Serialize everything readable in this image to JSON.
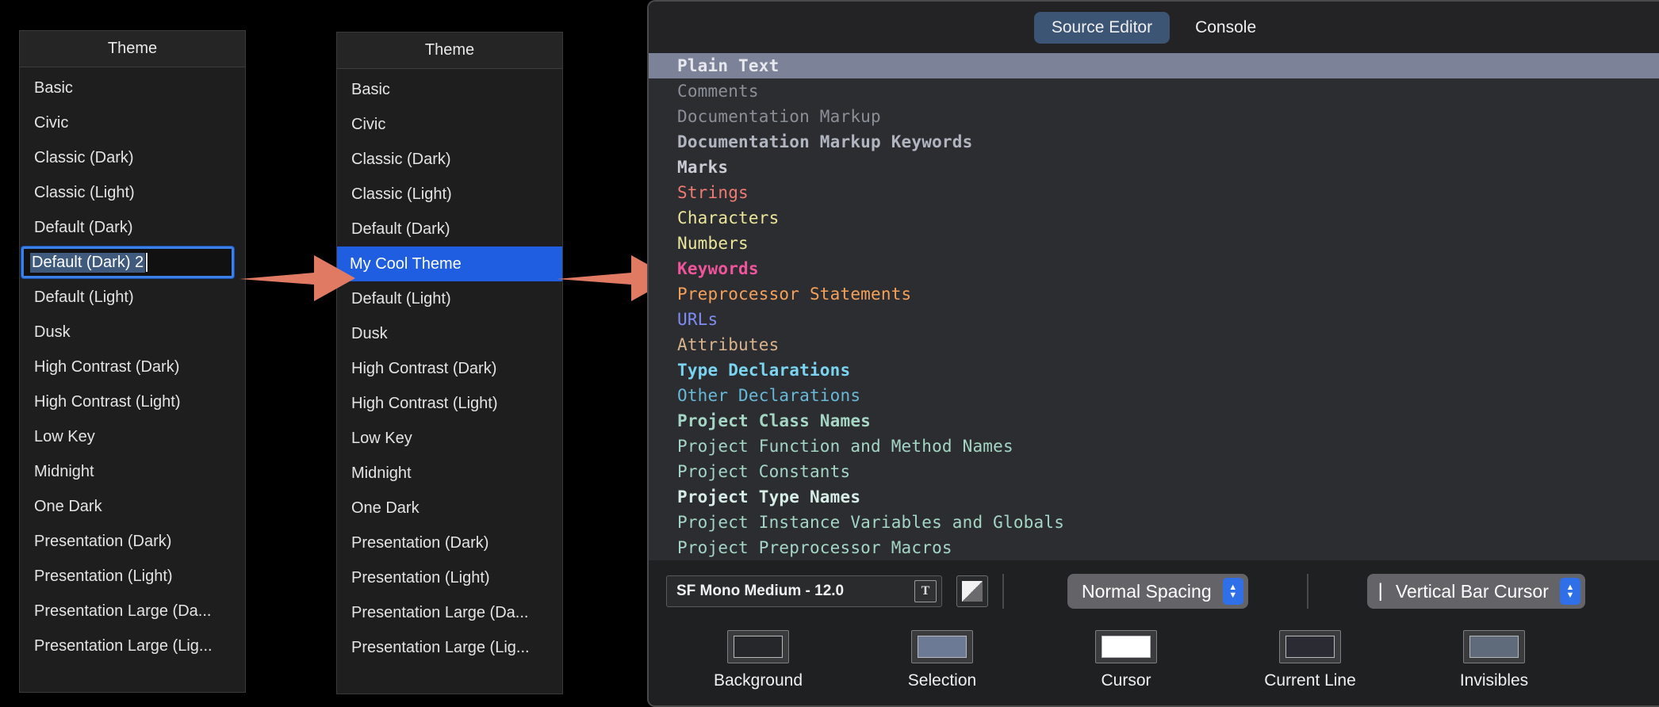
{
  "theme_panel_1": {
    "title": "Theme",
    "items": [
      {
        "label": "Basic",
        "state": "normal"
      },
      {
        "label": "Civic",
        "state": "normal"
      },
      {
        "label": "Classic (Dark)",
        "state": "normal"
      },
      {
        "label": "Classic (Light)",
        "state": "normal"
      },
      {
        "label": "Default (Dark)",
        "state": "normal"
      },
      {
        "label": "Default (Dark) 2",
        "state": "editing"
      },
      {
        "label": "Default (Light)",
        "state": "normal"
      },
      {
        "label": "Dusk",
        "state": "normal"
      },
      {
        "label": "High Contrast (Dark)",
        "state": "normal"
      },
      {
        "label": "High Contrast (Light)",
        "state": "normal"
      },
      {
        "label": "Low Key",
        "state": "normal"
      },
      {
        "label": "Midnight",
        "state": "normal"
      },
      {
        "label": "One Dark",
        "state": "normal"
      },
      {
        "label": "Presentation (Dark)",
        "state": "normal"
      },
      {
        "label": "Presentation (Light)",
        "state": "normal"
      },
      {
        "label": "Presentation Large (Da...",
        "state": "normal"
      },
      {
        "label": "Presentation Large (Lig...",
        "state": "normal"
      }
    ]
  },
  "theme_panel_2": {
    "title": "Theme",
    "items": [
      {
        "label": "Basic",
        "state": "normal"
      },
      {
        "label": "Civic",
        "state": "normal"
      },
      {
        "label": "Classic (Dark)",
        "state": "normal"
      },
      {
        "label": "Classic (Light)",
        "state": "normal"
      },
      {
        "label": "Default (Dark)",
        "state": "normal"
      },
      {
        "label": "My Cool Theme",
        "state": "selected"
      },
      {
        "label": "Default (Light)",
        "state": "normal"
      },
      {
        "label": "Dusk",
        "state": "normal"
      },
      {
        "label": "High Contrast (Dark)",
        "state": "normal"
      },
      {
        "label": "High Contrast (Light)",
        "state": "normal"
      },
      {
        "label": "Low Key",
        "state": "normal"
      },
      {
        "label": "Midnight",
        "state": "normal"
      },
      {
        "label": "One Dark",
        "state": "normal"
      },
      {
        "label": "Presentation (Dark)",
        "state": "normal"
      },
      {
        "label": "Presentation (Light)",
        "state": "normal"
      },
      {
        "label": "Presentation Large (Da...",
        "state": "normal"
      },
      {
        "label": "Presentation Large (Lig...",
        "state": "normal"
      }
    ]
  },
  "editor": {
    "tabs": [
      {
        "label": "Source Editor",
        "active": true
      },
      {
        "label": "Console",
        "active": false
      }
    ],
    "syntax_items": [
      {
        "label": "Plain Text",
        "color": "#e6e8ee",
        "bold": true,
        "selected": true
      },
      {
        "label": "Comments",
        "color": "#8b8f98",
        "bold": false,
        "selected": false
      },
      {
        "label": "Documentation Markup",
        "color": "#8b8f98",
        "bold": false,
        "selected": false
      },
      {
        "label": "Documentation Markup Keywords",
        "color": "#b0b5bf",
        "bold": true,
        "selected": false
      },
      {
        "label": "Marks",
        "color": "#c9ccd4",
        "bold": true,
        "selected": false
      },
      {
        "label": "Strings",
        "color": "#f07b74",
        "bold": false,
        "selected": false
      },
      {
        "label": "Characters",
        "color": "#ece69a",
        "bold": false,
        "selected": false
      },
      {
        "label": "Numbers",
        "color": "#ece69a",
        "bold": false,
        "selected": false
      },
      {
        "label": "Keywords",
        "color": "#f0559b",
        "bold": true,
        "selected": false
      },
      {
        "label": "Preprocessor Statements",
        "color": "#f5a15a",
        "bold": false,
        "selected": false
      },
      {
        "label": "URLs",
        "color": "#7f8df5",
        "bold": false,
        "selected": false
      },
      {
        "label": "Attributes",
        "color": "#d9b38c",
        "bold": false,
        "selected": false
      },
      {
        "label": "Type Declarations",
        "color": "#7ad4f0",
        "bold": true,
        "selected": false
      },
      {
        "label": "Other Declarations",
        "color": "#68b9d8",
        "bold": false,
        "selected": false
      },
      {
        "label": "Project Class Names",
        "color": "#a5d6c4",
        "bold": true,
        "selected": false
      },
      {
        "label": "Project Function and Method Names",
        "color": "#a5d6c4",
        "bold": false,
        "selected": false
      },
      {
        "label": "Project Constants",
        "color": "#a5d6c4",
        "bold": false,
        "selected": false
      },
      {
        "label": "Project Type Names",
        "color": "#d6ece4",
        "bold": true,
        "selected": false
      },
      {
        "label": "Project Instance Variables and Globals",
        "color": "#a5d6c4",
        "bold": false,
        "selected": false
      },
      {
        "label": "Project Preprocessor Macros",
        "color": "#a5d6c4",
        "bold": false,
        "selected": false
      }
    ],
    "toolbar": {
      "font_value": "SF Mono Medium - 12.0",
      "font_picker_icon": "text-format-icon",
      "contrast_icon": "half-filled-square-icon",
      "spacing_value": "Normal Spacing",
      "cursor_prefix": "|",
      "cursor_value": "Vertical Bar Cursor",
      "stepper_up": "▲",
      "stepper_down": "▼"
    },
    "color_wells": [
      {
        "label": "Background",
        "color": "#26272b"
      },
      {
        "label": "Selection",
        "color": "#6d7a96"
      },
      {
        "label": "Cursor",
        "color": "#ffffff"
      },
      {
        "label": "Current Line",
        "color": "#2b2c33"
      },
      {
        "label": "Invisibles",
        "color": "#5f6a7a"
      }
    ]
  },
  "annotations": {
    "arrow_color": "#e07a63",
    "arrow_1_name": "arrow-rename-to-theme",
    "arrow_2_name": "arrow-theme-to-keywords"
  }
}
